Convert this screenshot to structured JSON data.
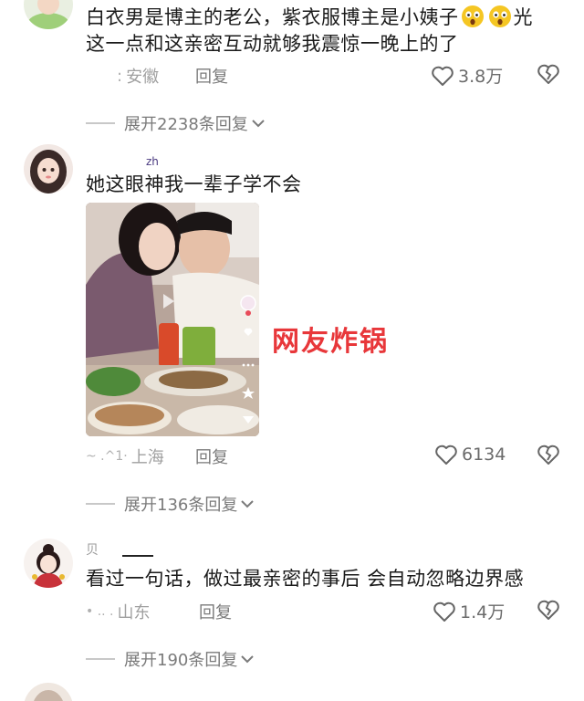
{
  "comments": [
    {
      "text_line1": "白衣男是博主的老公，紫衣服博主是小姨子",
      "text_line1_tail": "光",
      "text_line2": "这一点和这亲密互动就够我震惊一晚上的了",
      "time": ":",
      "location": "安徽",
      "reply": "回复",
      "likes": "3.8万",
      "expand": "展开2238条回复"
    },
    {
      "username": "zh",
      "text": "她这眼神我一辈子学不会",
      "image_caption": "网友炸锅",
      "time": "~ .^1·",
      "location": "上海",
      "reply": "回复",
      "likes": "6134",
      "expand": "展开136条回复"
    },
    {
      "username": "贝",
      "text": "看过一句话，做过最亲密的事后 会自动忽略边界感",
      "time": "• .. .",
      "location": "山东",
      "reply": "回复",
      "likes": "1.4万",
      "expand": "展开190条回复"
    }
  ],
  "colors": {
    "accent_red": "#e8373a",
    "meta_gray": "#a0a0a0",
    "reply_gray": "#7a7a7a"
  }
}
